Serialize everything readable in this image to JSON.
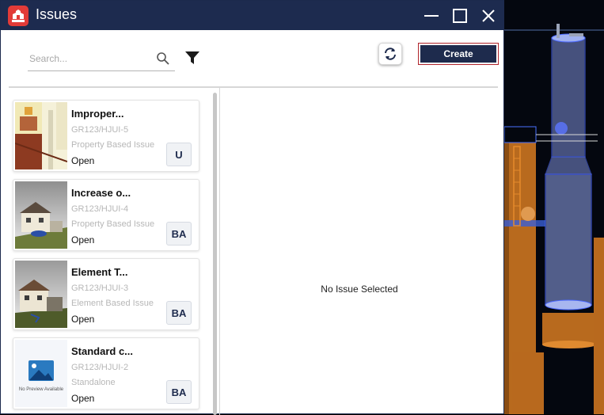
{
  "window": {
    "title": "Issues",
    "accent": "#1d2b4f",
    "brand_red": "#e23b38"
  },
  "toolbar": {
    "search_placeholder": "Search...",
    "search_value": "",
    "create_label": "Create",
    "filter_icon": "filter-icon",
    "refresh_icon": "refresh-icon"
  },
  "issues": [
    {
      "title": "Improper...",
      "code": "GR123/HJUI-5",
      "type": "Property Based Issue",
      "status": "Open",
      "assignee": "U"
    },
    {
      "title": "Increase o...",
      "code": "GR123/HJUI-4",
      "type": "Property Based Issue",
      "status": "Open",
      "assignee": "BA"
    },
    {
      "title": "Element T...",
      "code": "GR123/HJUI-3",
      "type": "Element Based Issue",
      "status": "Open",
      "assignee": "BA"
    },
    {
      "title": "Standard c...",
      "code": "GR123/HJUI-2",
      "type": "Standalone",
      "status": "Open",
      "assignee": "BA",
      "preview_text": "No Preview Available"
    }
  ],
  "detail": {
    "empty_message": "No Issue Selected"
  }
}
